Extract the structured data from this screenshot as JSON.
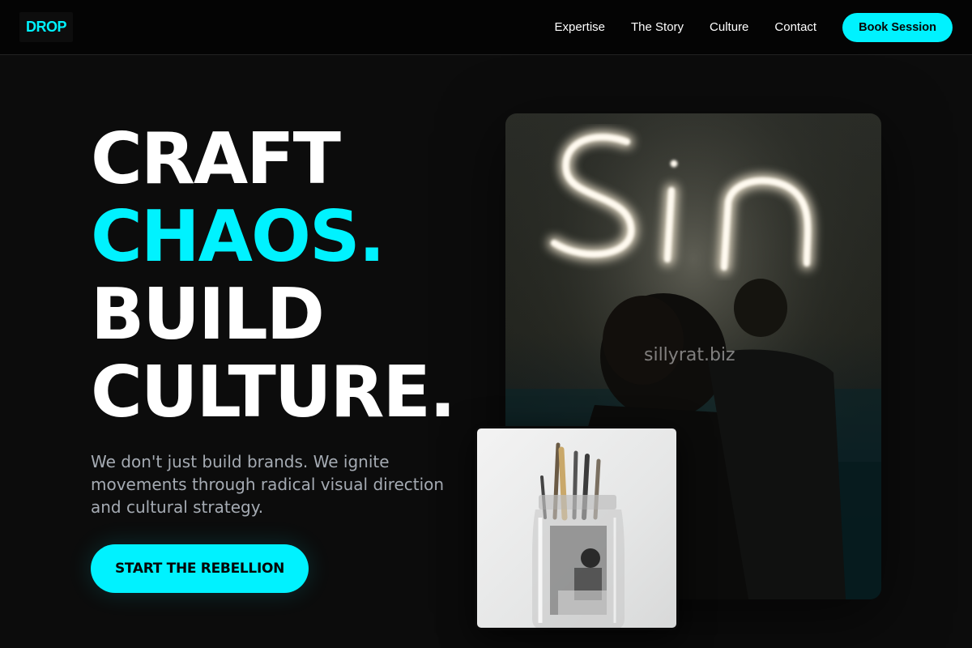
{
  "nav": {
    "logo": "DROP",
    "links": [
      "Expertise",
      "The Story",
      "Culture",
      "Contact"
    ],
    "cta": "Book Session"
  },
  "hero": {
    "headline": [
      "CRAFT",
      "CHAOS.",
      "BUILD",
      "CULTURE."
    ],
    "tagline": "We don't just build brands. We ignite movements through radical visual direction and cultural strategy.",
    "cta": "START THE REBELLION"
  },
  "media": {
    "main_image": {
      "neon_sign_text": "Sin",
      "watermark": "sillyrat.biz",
      "icon": "neon-sign-photo"
    },
    "inset_image": {
      "icon": "brush-jar-photo"
    }
  },
  "colors": {
    "accent": "#00f2ff",
    "background": "#0c0c0c",
    "text": "#ffffff",
    "muted": "#a5abb3"
  }
}
